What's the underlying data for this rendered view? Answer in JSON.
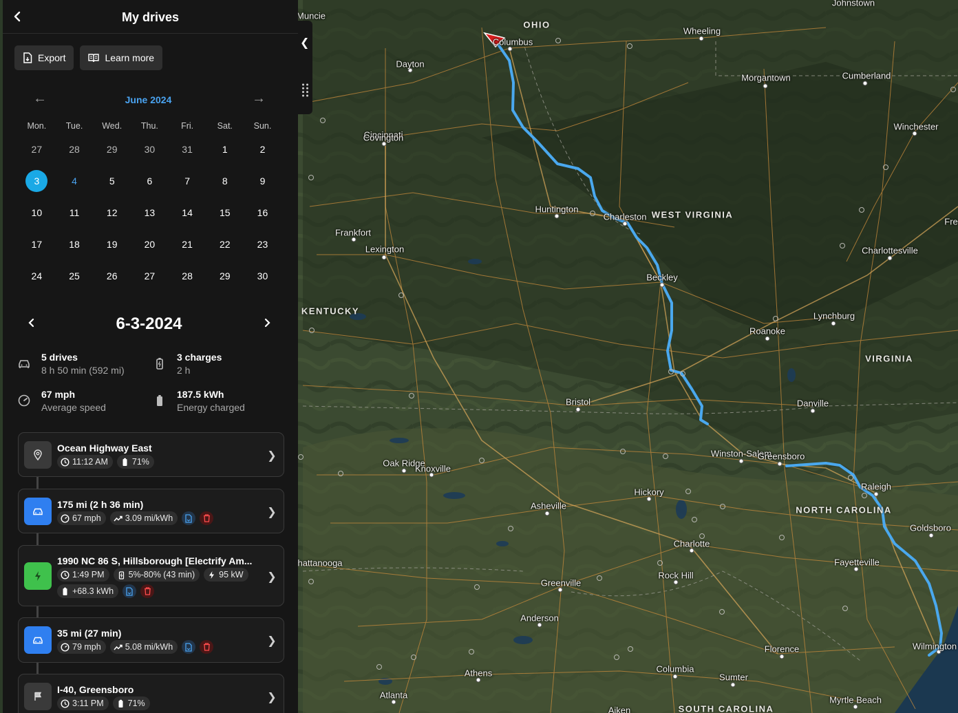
{
  "header": {
    "title": "My drives",
    "back_icon": "back-chevron-icon"
  },
  "actions": [
    {
      "label": "Export",
      "icon": "file-export-icon"
    },
    {
      "label": "Learn more",
      "icon": "book-icon"
    }
  ],
  "calendar": {
    "month": "June 2024",
    "weekdays": [
      "Mon.",
      "Tue.",
      "Wed.",
      "Thu.",
      "Fri.",
      "Sat.",
      "Sun."
    ],
    "weeks": [
      [
        {
          "d": "27",
          "cur": false
        },
        {
          "d": "28",
          "cur": false
        },
        {
          "d": "29",
          "cur": false
        },
        {
          "d": "30",
          "cur": false
        },
        {
          "d": "31",
          "cur": false
        },
        {
          "d": "1",
          "cur": true
        },
        {
          "d": "2",
          "cur": true
        }
      ],
      [
        {
          "d": "3",
          "cur": true,
          "selected": true
        },
        {
          "d": "4",
          "cur": true,
          "has_drives": true
        },
        {
          "d": "5",
          "cur": true
        },
        {
          "d": "6",
          "cur": true
        },
        {
          "d": "7",
          "cur": true
        },
        {
          "d": "8",
          "cur": true
        },
        {
          "d": "9",
          "cur": true
        }
      ],
      [
        {
          "d": "10",
          "cur": true
        },
        {
          "d": "11",
          "cur": true
        },
        {
          "d": "12",
          "cur": true
        },
        {
          "d": "13",
          "cur": true
        },
        {
          "d": "14",
          "cur": true
        },
        {
          "d": "15",
          "cur": true
        },
        {
          "d": "16",
          "cur": true
        }
      ],
      [
        {
          "d": "17",
          "cur": true
        },
        {
          "d": "18",
          "cur": true
        },
        {
          "d": "19",
          "cur": true
        },
        {
          "d": "20",
          "cur": true
        },
        {
          "d": "21",
          "cur": true
        },
        {
          "d": "22",
          "cur": true
        },
        {
          "d": "23",
          "cur": true
        }
      ],
      [
        {
          "d": "24",
          "cur": true
        },
        {
          "d": "25",
          "cur": true
        },
        {
          "d": "26",
          "cur": true
        },
        {
          "d": "27",
          "cur": true
        },
        {
          "d": "28",
          "cur": true
        },
        {
          "d": "29",
          "cur": true
        },
        {
          "d": "30",
          "cur": true
        }
      ]
    ]
  },
  "selected_date": "6-3-2024",
  "summary": {
    "drives": {
      "value": "5 drives",
      "sub": "8 h 50 min (592 mi)",
      "icon": "car-icon"
    },
    "charges": {
      "value": "3 charges",
      "sub": "2 h",
      "icon": "battery-icon"
    },
    "speed": {
      "value": "67 mph",
      "sub": "Average speed",
      "icon": "speedometer-icon"
    },
    "energy": {
      "value": "187.5 kWh",
      "sub": "Energy charged",
      "icon": "battery-full-icon"
    }
  },
  "timeline": [
    {
      "type": "location",
      "title": "Ocean Highway East",
      "time": "11:12 AM",
      "battery": "71%",
      "icon_color": "#3a3a3a"
    },
    {
      "type": "drive",
      "title": "175 mi (2 h 36 min)",
      "speed": "67 mph",
      "efficiency": "3.09 mi/kWh",
      "icon_color": "#2f7ff0"
    },
    {
      "type": "charge",
      "title": "1990 NC 86 S, Hillsborough [Electrify Am...",
      "time": "1:49 PM",
      "soc": "5%-80% (43 min)",
      "power": "95 kW",
      "energy": "+68.3 kWh",
      "icon_color": "#3fc14c"
    },
    {
      "type": "drive",
      "title": "35 mi (27 min)",
      "speed": "79 mph",
      "efficiency": "5.08 mi/kWh",
      "icon_color": "#2f7ff0"
    },
    {
      "type": "location",
      "title": "I-40, Greensboro",
      "time": "3:11 PM",
      "battery": "71%",
      "icon_color": "#3a3a3a"
    }
  ],
  "map": {
    "route_color": "#4aa8ee",
    "cities": [
      "Muncie",
      "Columbus",
      "Dayton",
      "Wheeling",
      "Johnstown",
      "Morgantown",
      "Cumberland",
      "Cincinnati",
      "Covington",
      "Winchester",
      "Huntington",
      "Charleston",
      "Frankfort",
      "Lexington",
      "Beckley",
      "Charlottesville",
      "Lynchburg",
      "Roanoke",
      "Bristol",
      "Danville",
      "Oak Ridge",
      "Knoxville",
      "Winston-Salem",
      "Greensboro",
      "Raleigh",
      "Hickory",
      "Asheville",
      "Goldsboro",
      "Charlotte",
      "Fayetteville",
      "Rock Hill",
      "Greenville",
      "Anderson",
      "Chattanooga",
      "Florence",
      "Columbia",
      "Sumter",
      "Wilmington",
      "Athens",
      "Atlanta",
      "Myrtle Beach",
      "Aiken",
      "Fre"
    ],
    "city_label_text": {
      "chattanooga": "hattanooga",
      "fre": "Fre",
      "cincinnati": "Cincinnati",
      "covington": "Covington"
    },
    "states": [
      "OHIO",
      "WEST VIRGINIA",
      "KENTUCKY",
      "VIRGINIA",
      "NORTH CAROLINA",
      "SOUTH CAROLINA"
    ],
    "collapse_icon": "collapse-chevron-icon",
    "grip_icon": "drag-grip-icon"
  }
}
